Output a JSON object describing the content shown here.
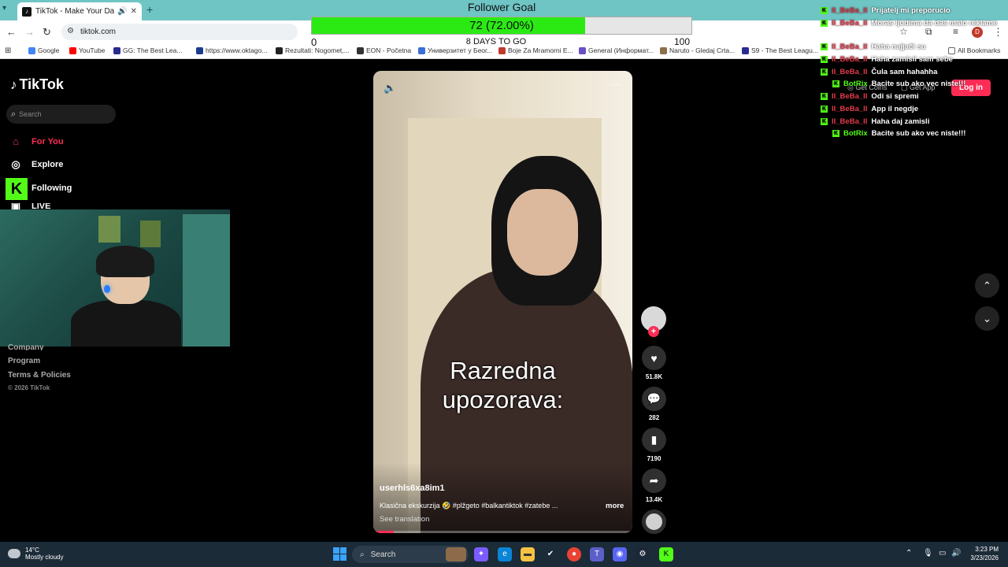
{
  "browser": {
    "tab_title": "TikTok - Make Your Day",
    "new_tab": "+",
    "address": "tiktok.com",
    "bookmarks": [
      {
        "label": "Google",
        "color": "#4285f4"
      },
      {
        "label": "YouTube",
        "color": "#ff0000"
      },
      {
        "label": "GG: The Best Lea...",
        "color": "#2a2a8f"
      },
      {
        "label": "https://www.oktago...",
        "color": "#1b3b8f"
      },
      {
        "label": "Rezultati: Nogomet,...",
        "color": "#222"
      },
      {
        "label": "EON - Početna",
        "color": "#333"
      },
      {
        "label": "Универзитет у Беог...",
        "color": "#3a6fd8"
      },
      {
        "label": "Boje Za Mramorni E...",
        "color": "#c0392b"
      },
      {
        "label": "General (Информат...",
        "color": "#6a4fc7"
      },
      {
        "label": "Naruto - Gledaj Crta...",
        "color": "#8d6e4a"
      },
      {
        "label": "S9 - The Best Leagu...",
        "color": "#2a2a8f"
      }
    ],
    "all_bookmarks": "All Bookmarks"
  },
  "goal": {
    "title": "Follower Goal",
    "bar_text": "72 (72.00%)",
    "progress": 0.72,
    "min": "0",
    "max": "100",
    "days": "8 DAYS TO GO"
  },
  "chat": [
    {
      "user": "II_BeBa_II",
      "msg": "Prijatelj mi preporucio",
      "color": "#e23b4a"
    },
    {
      "user": "II_BeBa_II",
      "msg": "Moraš ljudima da daš malo reklame",
      "color": "#e23b4a"
    },
    {
      "user": "II_BeBa_II",
      "msg": "Haha najjači su",
      "color": "#e23b4a"
    },
    {
      "user": "II_BeBa_II",
      "msg": "Haha zamisli sam sebe",
      "color": "#e23b4a"
    },
    {
      "user": "II_BeBa_II",
      "msg": "Čula sam hahahha",
      "color": "#e23b4a"
    },
    {
      "user": "BotRix",
      "msg": "Bacite sub ako vec niste!!!",
      "color": "#53fc18"
    },
    {
      "user": "II_BeBa_II",
      "msg": "Odi si spremi",
      "color": "#e23b4a"
    },
    {
      "user": "II_BeBa_II",
      "msg": "App il negdje",
      "color": "#e23b4a"
    },
    {
      "user": "II_BeBa_II",
      "msg": "Haha daj zamisli",
      "color": "#e23b4a"
    },
    {
      "user": "BotRix",
      "msg": "Bacite sub ako vec niste!!!",
      "color": "#53fc18"
    }
  ],
  "tiktok": {
    "logo": "TikTok",
    "search_placeholder": "Search",
    "nav": {
      "for_you": "For You",
      "explore": "Explore",
      "following": "Following",
      "live": "LIVE"
    },
    "footer": {
      "company": "Company",
      "program": "Program",
      "terms": "Terms & Policies",
      "copyright": "© 2026 TikTok"
    },
    "get_coins": "Get Coins",
    "get_app": "Get App",
    "login": "Log in",
    "video": {
      "overlay_line1": "Razredna",
      "overlay_line2": "upozorava:",
      "author": "userhls6xa8im1",
      "caption": "Klasična ekskurzija 🤣 #plžgeto #balkantiktok #zatebe ...",
      "more": "more",
      "see_translation": "See translation",
      "progress": 0.08
    },
    "actions": {
      "likes": "51.8K",
      "comments": "282",
      "saves": "7190",
      "shares": "13.4K"
    }
  },
  "taskbar": {
    "temp": "14°C",
    "weather": "Mostly cloudy",
    "search": "Search",
    "time": "3:23 PM",
    "date": "3/23/2026"
  },
  "colors": {
    "accent": "#fe2c55",
    "goal_fill": "#2bea14",
    "kick_green": "#53fc18"
  }
}
